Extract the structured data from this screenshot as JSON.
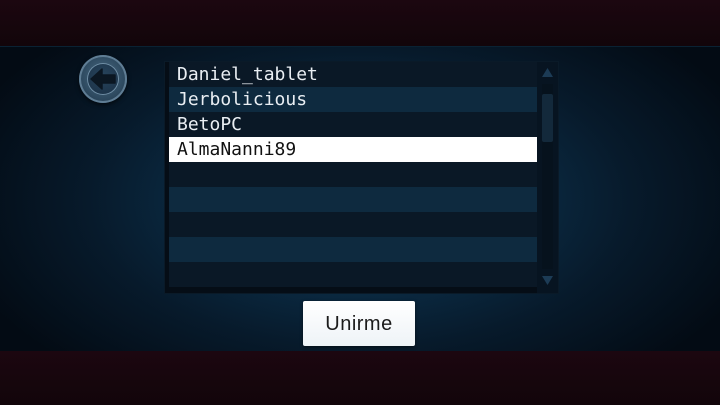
{
  "games_list": {
    "rows": [
      {
        "label": "Daniel_tablet"
      },
      {
        "label": "Jerbolicious"
      },
      {
        "label": "BetoPC"
      },
      {
        "label": "AlmaNanni89"
      },
      {
        "label": ""
      },
      {
        "label": ""
      },
      {
        "label": ""
      },
      {
        "label": ""
      },
      {
        "label": ""
      }
    ],
    "selected_index": 3
  },
  "icons": {
    "back": "arrow-left-icon",
    "scroll_up": "triangle-up-icon",
    "scroll_down": "triangle-down-icon"
  },
  "actions": {
    "join_label": "Unirme"
  },
  "colors": {
    "panel": "#0b2c45",
    "row_dark": "#0a1826",
    "row_light": "#0e2a3f",
    "selected_row": "#ffffff",
    "band": "#1c0710"
  }
}
